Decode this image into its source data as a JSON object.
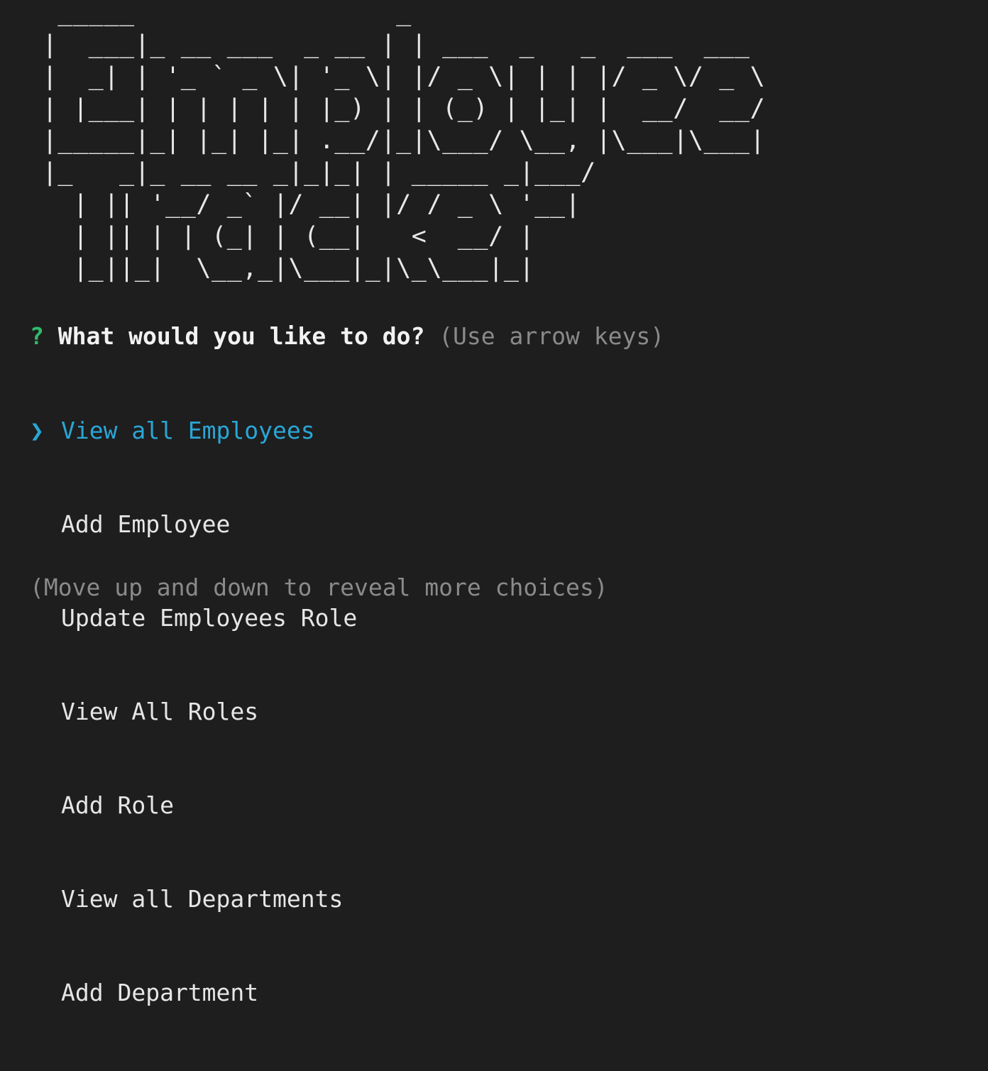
{
  "banner": {
    "ascii_art": "  _____                 _\n |  ___|_ __ ___  _ __ | | ___  _   _  ___  ___\n |  _| | '_ ` _ \\| '_ \\| |/ _ \\| | | |/ _ \\/ _ \\\n | |___| | | | | | |_) | | (_) | |_| |  __/  __/\n |_____|_| |_| |_| .__/|_|\\___/ \\__, |\\___|\\___|\n |_   _|_ __ __ _|_|_| | _____ _|___/\n   | || '__/ _` |/ __| |/ / _ \\ '__|\n   | || | | (_| | (__|   <  __/ |\n   |_||_|  \\__,_|\\___|_|\\_\\___|_|"
  },
  "prompt": {
    "symbol": "?",
    "question": "What would you like to do?",
    "hint": "(Use arrow keys)"
  },
  "choices": {
    "pointer_symbol": "❯",
    "items": [
      {
        "label": "View all Employees",
        "selected": true
      },
      {
        "label": "Add Employee",
        "selected": false
      },
      {
        "label": "Update Employees Role",
        "selected": false
      },
      {
        "label": "View All Roles",
        "selected": false
      },
      {
        "label": "Add Role",
        "selected": false
      },
      {
        "label": "View all Departments",
        "selected": false
      },
      {
        "label": "Add Department",
        "selected": false
      }
    ]
  },
  "footer": {
    "hint": "(Move up and down to reveal more choices)"
  },
  "colors": {
    "background": "#1e1e1e",
    "selected": "#2aa6d6",
    "question_mark": "#2ebd6b",
    "muted": "#8a8a8a"
  }
}
